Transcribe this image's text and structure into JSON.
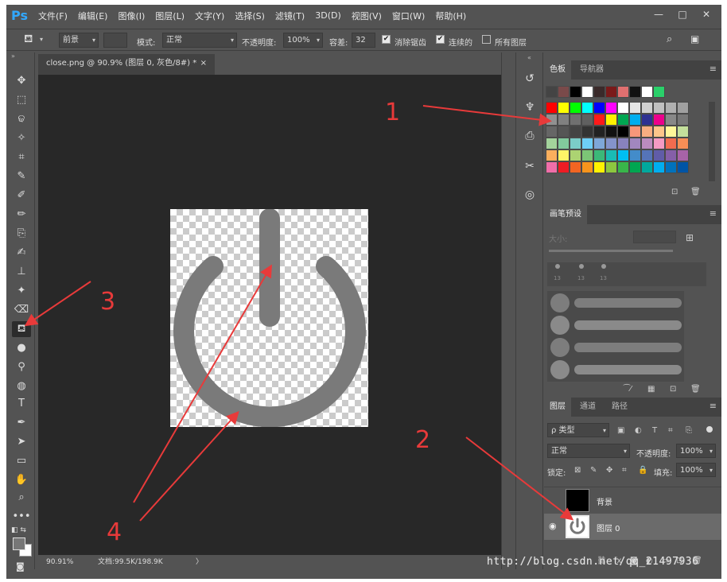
{
  "app": {
    "logo": "Ps"
  },
  "menu": [
    "文件(F)",
    "编辑(E)",
    "图像(I)",
    "图层(L)",
    "文字(Y)",
    "选择(S)",
    "滤镜(T)",
    "3D(D)",
    "视图(V)",
    "窗口(W)",
    "帮助(H)"
  ],
  "window_controls": [
    "—",
    "□",
    "✕"
  ],
  "options": {
    "preset": "前景",
    "mode_label": "模式:",
    "mode_value": "正常",
    "opacity_label": "不透明度:",
    "opacity_value": "100%",
    "tolerance_label": "容差:",
    "tolerance_value": "32",
    "antialias_label": "消除锯齿",
    "contiguous_label": "连续的",
    "all_layers_label": "所有图层"
  },
  "document": {
    "tab_title": "close.png @ 90.9% (图层 0, 灰色/8#) *",
    "tab_close": "×",
    "zoom": "90.91%",
    "doc_info": "文档:99.5K/198.9K",
    "arrow": "〉"
  },
  "swatches_panel": {
    "tabs": [
      "色板",
      "导航器"
    ],
    "recent": [
      "#444444",
      "#7a4a4a",
      "#000000",
      "#ffffff",
      "#3a2a2a",
      "#7a1a1a",
      "#e07070",
      "#111111",
      "#ffffff",
      "#2ad06a"
    ],
    "grid": [
      [
        "#ff0000",
        "#ffff00",
        "#00ff00",
        "#00ffff",
        "#0000ff",
        "#ff00ff",
        "#ffffff",
        "#e5e5e5",
        "#d0d0d0",
        "#c0c0c0",
        "#b0b0b0",
        "#a0a0a0"
      ],
      [
        "#909090",
        "#808080",
        "#707070",
        "#606060",
        "#ff1a1a",
        "#fff200",
        "#00a651",
        "#00aeef",
        "#2e3192",
        "#ec008c",
        "#888888",
        "#777777"
      ],
      [
        "#666666",
        "#555555",
        "#444444",
        "#333333",
        "#222222",
        "#111111",
        "#000000",
        "#f7977a",
        "#f9ad81",
        "#fdc68a",
        "#fff79a",
        "#c4df9b"
      ],
      [
        "#a3d39c",
        "#82ca9d",
        "#7bcdc8",
        "#6ecff6",
        "#7ea7d8",
        "#8493ca",
        "#8882be",
        "#a187be",
        "#bc8cbf",
        "#f49ac2",
        "#f26c4f",
        "#f68e56"
      ],
      [
        "#fbaf5d",
        "#fff467",
        "#acd372",
        "#7cc576",
        "#3bb878",
        "#1abbb4",
        "#00bff3",
        "#438cca",
        "#5574b9",
        "#605ca8",
        "#855fa8",
        "#a763a8"
      ],
      [
        "#f06ea9",
        "#ed1c24",
        "#f26522",
        "#f7941d",
        "#fff200",
        "#8dc73f",
        "#39b54a",
        "#00a651",
        "#00a99d",
        "#00aeef",
        "#0072bc",
        "#0054a6"
      ]
    ]
  },
  "brush_panel": {
    "title": "画笔预设",
    "size_label": "大小:",
    "sizes": [
      "13",
      "13",
      "13"
    ]
  },
  "layers_panel": {
    "tabs": [
      "图层",
      "通道",
      "路径"
    ],
    "filter_label": "ρ 类型",
    "blend_mode": "正常",
    "opacity_label": "不透明度:",
    "opacity_value": "100%",
    "lock_label": "锁定:",
    "fill_label": "填充:",
    "fill_value": "100%",
    "layers": [
      {
        "name": "背景"
      },
      {
        "name": "图层 0"
      }
    ]
  },
  "annotations": [
    "1",
    "2",
    "3",
    "4"
  ],
  "watermark": "http://blog.csdn.net/qq_21497936"
}
